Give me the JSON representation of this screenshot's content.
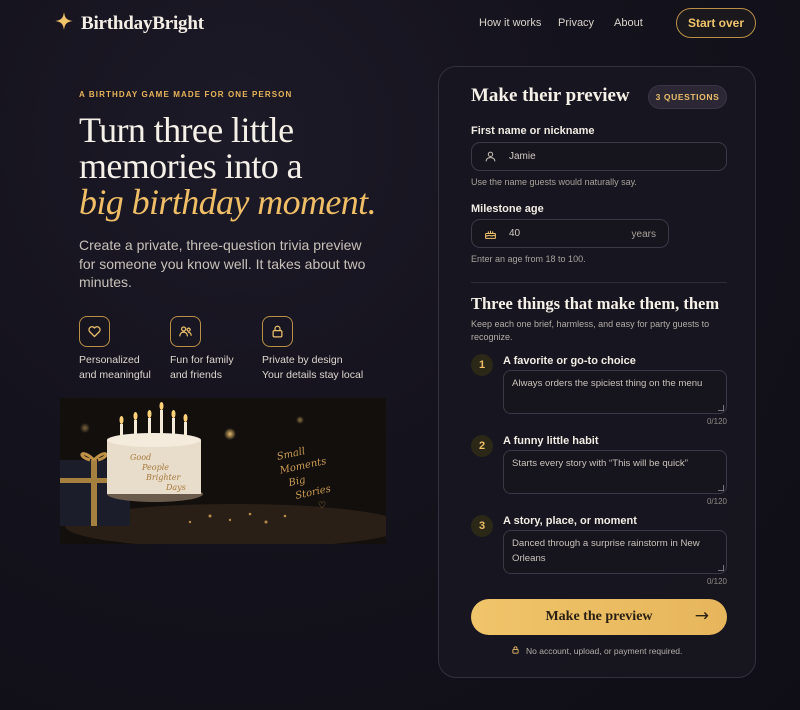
{
  "header": {
    "brand": "BirthdayBright",
    "nav": [
      "How it works",
      "Privacy",
      "About"
    ],
    "start_over": "Start over"
  },
  "hero": {
    "eyebrow": "A BIRTHDAY GAME MADE FOR ONE PERSON",
    "headline_line1": "Turn three little",
    "headline_line2": "memories into a",
    "headline_accent": "big birthday moment.",
    "lede": "Create a private, three-question trivia preview for someone you know well. It takes about two minutes.",
    "features": [
      {
        "icon": "heart-icon",
        "line1": "Personalized",
        "line2": "and meaningful"
      },
      {
        "icon": "people-icon",
        "line1": "Fun for family",
        "line2": "and friends"
      },
      {
        "icon": "lock-icon",
        "line1": "Private by design",
        "line2": "Your details stay local"
      }
    ],
    "image": {
      "cake_text": [
        "Good",
        "People",
        "Brighter",
        "Days"
      ],
      "card_text": [
        "Small",
        "Moments",
        "Big",
        "Stories"
      ]
    }
  },
  "form": {
    "title": "Make their preview",
    "badge": "3 QUESTIONS",
    "name": {
      "label": "First name or nickname",
      "value": "Jamie",
      "hint": "Use the name guests would naturally say."
    },
    "age": {
      "label": "Milestone age",
      "value": "40",
      "suffix": "years",
      "hint": "Enter an age from 18 to 100."
    },
    "section_title": "Three things that make them, them",
    "section_desc": "Keep each one brief, harmless, and easy for party guests to recognize.",
    "questions": [
      {
        "number": "1",
        "label": "A favorite or go-to choice",
        "value": "Always orders the spiciest thing on the menu",
        "count": "0/120"
      },
      {
        "number": "2",
        "label": "A funny little habit",
        "value": "Starts every story with “This will be quick”",
        "count": "0/120"
      },
      {
        "number": "3",
        "label": "A story, place, or moment",
        "value": "Danced through a surprise rainstorm in New Orleans",
        "count": "0/120"
      }
    ],
    "submit": "Make the preview",
    "footnote": "No account, upload, or payment required."
  },
  "colors": {
    "accent": "#f0c46a",
    "background": "#14121c",
    "card": "#18161f"
  }
}
